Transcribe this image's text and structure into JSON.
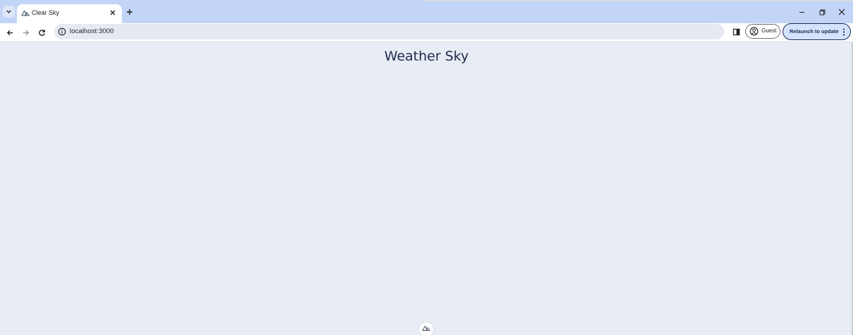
{
  "browser": {
    "tab": {
      "title": "Clear Sky"
    },
    "address_bar": {
      "url": "localhost:3000"
    },
    "profile": {
      "label": "Guest"
    },
    "update_button": {
      "label": "Relaunch to update"
    },
    "icons": {
      "tab_search": "chevron-down-icon",
      "favicon": "nuxt-logo-icon",
      "tab_close": "close-icon",
      "new_tab": "plus-icon",
      "minimize": "minimize-icon",
      "restore": "restore-icon",
      "close_window": "close-icon",
      "back": "arrow-left-icon",
      "forward": "arrow-right-icon",
      "reload": "reload-icon",
      "site_info": "info-icon",
      "side_panel": "side-panel-icon",
      "profile": "account-circle-icon",
      "menu": "more-vertical-icon"
    },
    "colors": {
      "tabstrip": "#c3d5f7",
      "page_background": "#e8edf5",
      "title_text": "#1e2a4a",
      "update_chip": "#d3e3fd"
    }
  },
  "page": {
    "title": "Weather Sky"
  }
}
